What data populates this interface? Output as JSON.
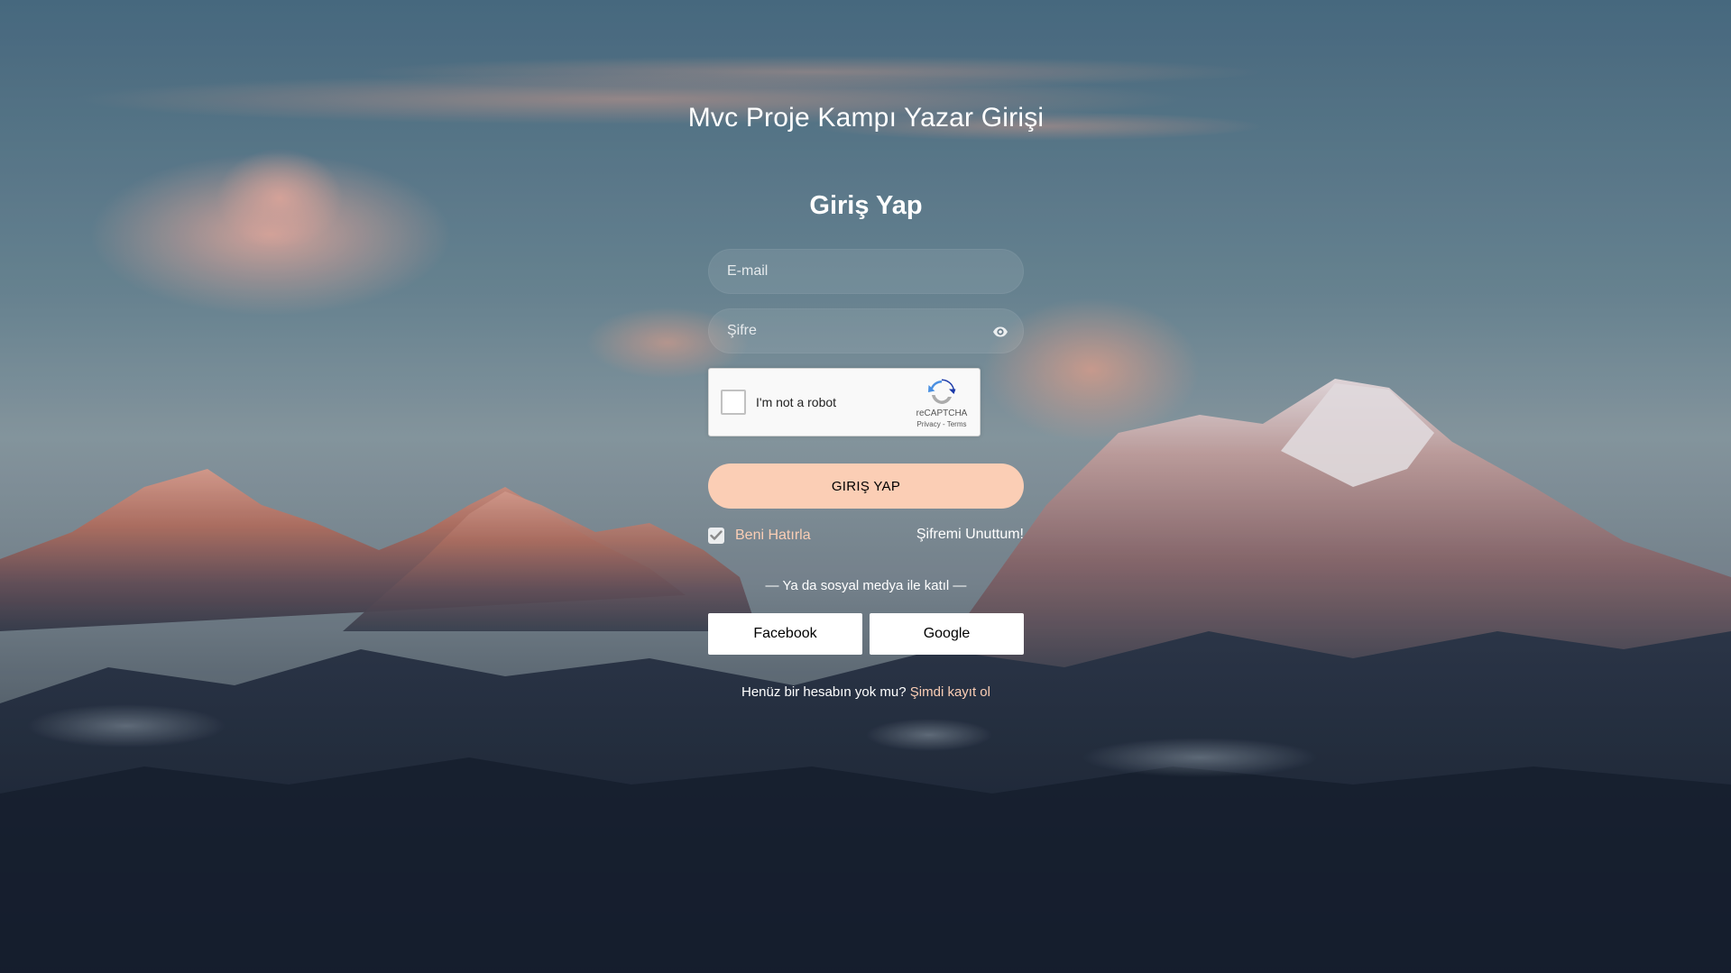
{
  "page": {
    "site_title": "Mvc Proje Kampı Yazar Girişi",
    "form_heading": "Giriş Yap"
  },
  "form": {
    "email_placeholder": "E-mail",
    "email_value": "",
    "password_placeholder": "Şifre",
    "password_value": "",
    "password_toggle_icon": "eye-icon",
    "submit_label": "GIRIŞ YAP",
    "remember_label": "Beni Hatırla",
    "remember_checked": true,
    "forgot_label": "Şifremi Unuttum!"
  },
  "recaptcha": {
    "label": "I'm not a robot",
    "brand": "reCAPTCHA",
    "privacy": "Privacy",
    "separator": " - ",
    "terms": "Terms",
    "checked": false
  },
  "social": {
    "divider_text": "— Ya da sosyal medya ile katıl —",
    "facebook_label": "Facebook",
    "google_label": "Google"
  },
  "signup": {
    "prompt": "Henüz bir hesabın yok mu? ",
    "link_label": "Şimdi kayıt ol"
  },
  "colors": {
    "accent": "#fbceb5",
    "field_bg": "rgba(255,255,255,0.09)",
    "text": "#ffffff"
  }
}
